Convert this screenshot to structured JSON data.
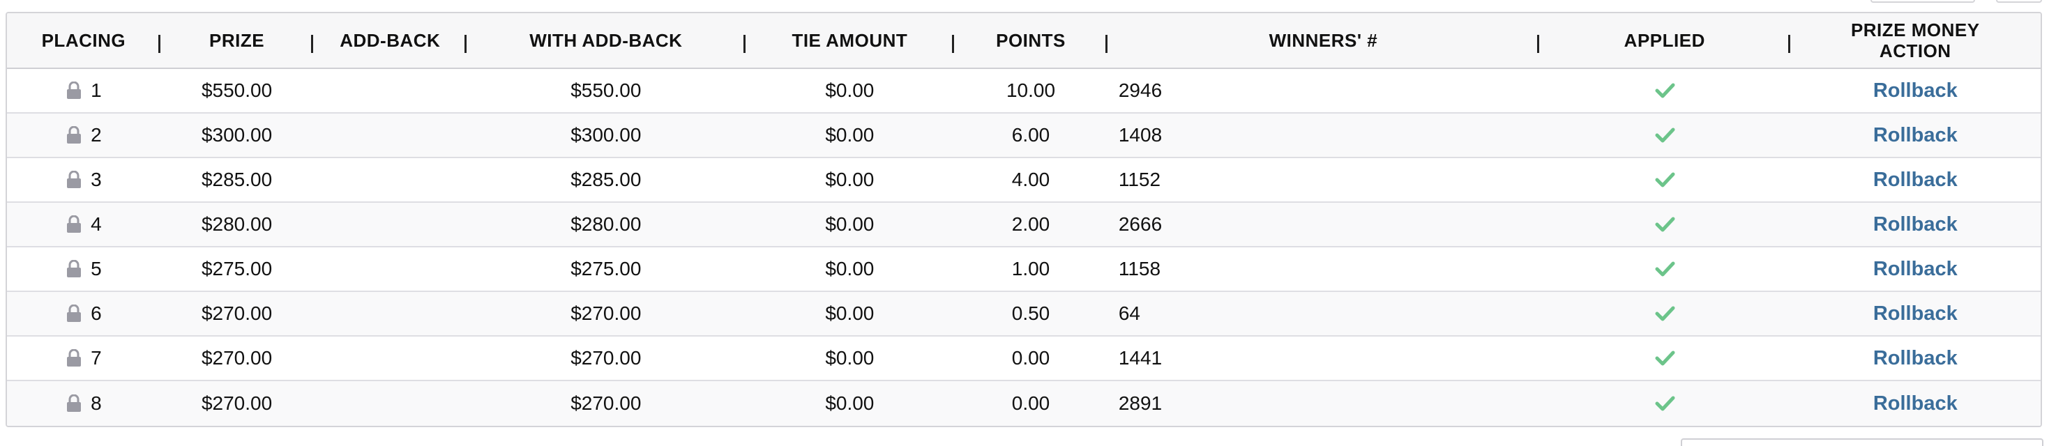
{
  "table": {
    "headers": {
      "placing": "PLACING",
      "prize": "PRIZE",
      "add_back": "ADD-BACK",
      "with_add_back": "WITH ADD-BACK",
      "tie_amount": "TIE AMOUNT",
      "points": "POINTS",
      "winners": "WINNERS' #",
      "applied": "APPLIED",
      "action_line1": "PRIZE MONEY",
      "action_line2": "ACTION"
    },
    "rows": [
      {
        "placing": "1",
        "prize": "$550.00",
        "add_back": "",
        "with_add_back": "$550.00",
        "tie_amount": "$0.00",
        "points": "10.00",
        "winners": "2946",
        "applied": true,
        "action": "Rollback"
      },
      {
        "placing": "2",
        "prize": "$300.00",
        "add_back": "",
        "with_add_back": "$300.00",
        "tie_amount": "$0.00",
        "points": "6.00",
        "winners": "1408",
        "applied": true,
        "action": "Rollback"
      },
      {
        "placing": "3",
        "prize": "$285.00",
        "add_back": "",
        "with_add_back": "$285.00",
        "tie_amount": "$0.00",
        "points": "4.00",
        "winners": "1152",
        "applied": true,
        "action": "Rollback"
      },
      {
        "placing": "4",
        "prize": "$280.00",
        "add_back": "",
        "with_add_back": "$280.00",
        "tie_amount": "$0.00",
        "points": "2.00",
        "winners": "2666",
        "applied": true,
        "action": "Rollback"
      },
      {
        "placing": "5",
        "prize": "$275.00",
        "add_back": "",
        "with_add_back": "$275.00",
        "tie_amount": "$0.00",
        "points": "1.00",
        "winners": "1158",
        "applied": true,
        "action": "Rollback"
      },
      {
        "placing": "6",
        "prize": "$270.00",
        "add_back": "",
        "with_add_back": "$270.00",
        "tie_amount": "$0.00",
        "points": "0.50",
        "winners": "64",
        "applied": true,
        "action": "Rollback"
      },
      {
        "placing": "7",
        "prize": "$270.00",
        "add_back": "",
        "with_add_back": "$270.00",
        "tie_amount": "$0.00",
        "points": "0.00",
        "winners": "1441",
        "applied": true,
        "action": "Rollback"
      },
      {
        "placing": "8",
        "prize": "$270.00",
        "add_back": "",
        "with_add_back": "$270.00",
        "tie_amount": "$0.00",
        "points": "0.00",
        "winners": "2891",
        "applied": true,
        "action": "Rollback"
      }
    ]
  },
  "icons": {
    "placing_icon": "lock-icon",
    "applied_icon": "checkmark-icon"
  },
  "colors": {
    "link": "#3a6d9a",
    "check": "#6cc48a",
    "lock": "#9a9aa3"
  }
}
